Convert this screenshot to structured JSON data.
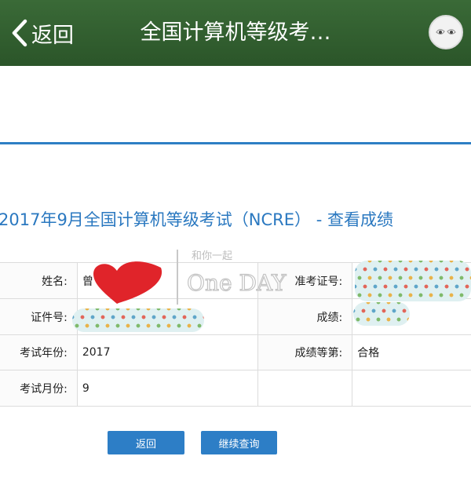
{
  "header": {
    "back_label": "返回",
    "title": "全国计算机等级考…"
  },
  "page": {
    "heading": "2017年9月全国计算机等级考试（NCRE） - 查看成绩"
  },
  "results": {
    "name_label": "姓名:",
    "name_value": "曾",
    "ticket_label": "准考证号:",
    "id_label": "证件号:",
    "score_label": "成绩:",
    "year_label": "考试年份:",
    "year_value": "2017",
    "grade_label": "成绩等第:",
    "grade_value": "合格",
    "month_label": "考试月份:",
    "month_value": "9"
  },
  "buttons": {
    "back": "返回",
    "continue": "继续查询"
  },
  "sticker": {
    "line1": "和你一起",
    "line2": "One DAY"
  },
  "colors": {
    "header_bg": "#2f5e2d",
    "accent": "#2e7fc4",
    "heart": "#e0242a"
  }
}
